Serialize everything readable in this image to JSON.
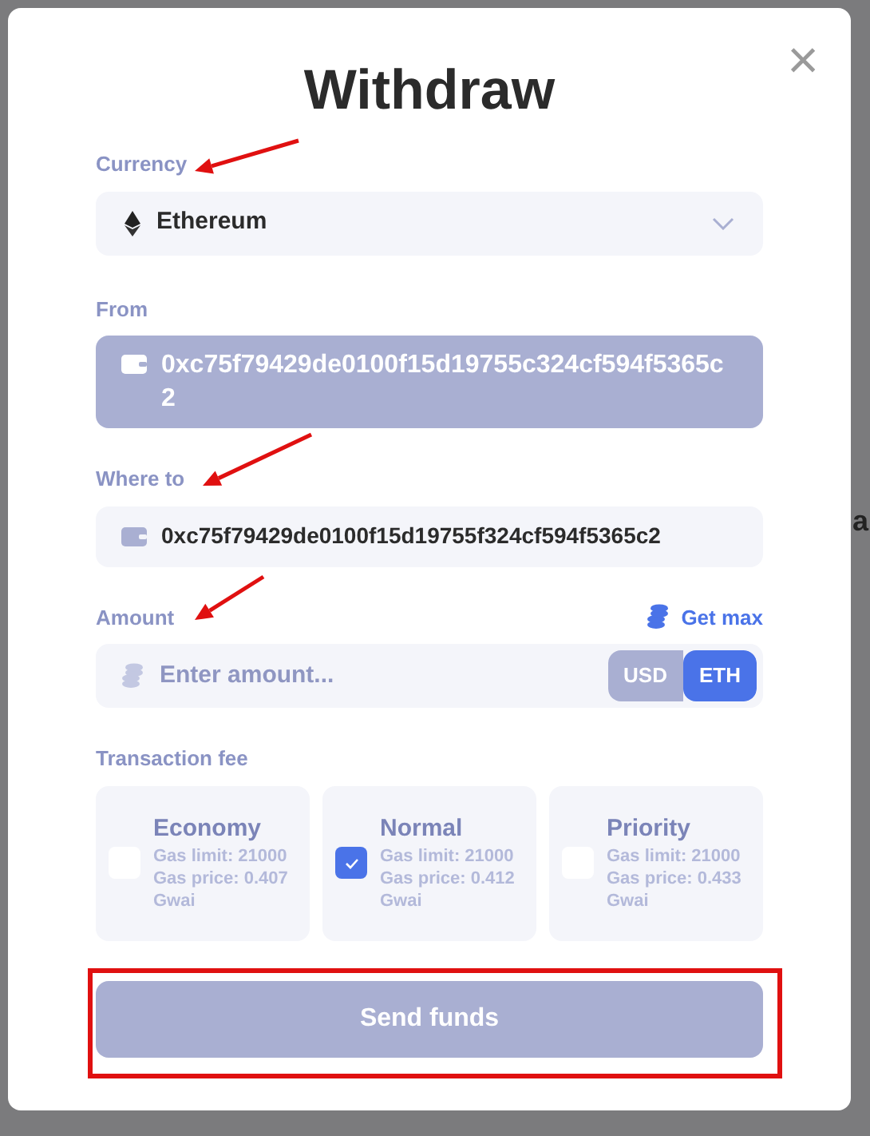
{
  "background_fragments": [
    "a"
  ],
  "dialog": {
    "title": "Withdraw",
    "close": "×"
  },
  "currency": {
    "label": "Currency",
    "value": "Ethereum"
  },
  "from": {
    "label": "From",
    "value": "0xc75f79429de0100f15d19755c324cf594f5365c2",
    "disabled": true
  },
  "where_to": {
    "label": "Where to",
    "value": "0xc75f79429de0100f15d19755f324cf594f5365c2"
  },
  "amount": {
    "label": "Amount",
    "get_max": "Get max",
    "placeholder": "Enter amount...",
    "units": [
      {
        "label": "USD",
        "selected": false
      },
      {
        "label": "ETH",
        "selected": true
      }
    ]
  },
  "fee": {
    "label": "Transaction fee",
    "options": [
      {
        "title": "Economy",
        "gas_limit": "Gas limit: 21000",
        "gas_price": "Gas price: 0.407 Gwai",
        "checked": false
      },
      {
        "title": "Normal",
        "gas_limit": "Gas limit: 21000",
        "gas_price": "Gas price: 0.412 Gwai",
        "checked": true
      },
      {
        "title": "Priority",
        "gas_limit": "Gas limit: 21000",
        "gas_price": "Gas price: 0.433 Gwai",
        "checked": false
      }
    ]
  },
  "submit": {
    "label": "Send funds"
  }
}
